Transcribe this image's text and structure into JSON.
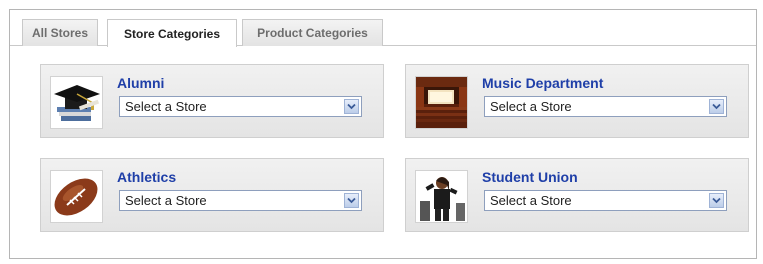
{
  "tabs": [
    {
      "label": "All Stores",
      "active": false
    },
    {
      "label": "Store Categories",
      "active": true
    },
    {
      "label": "Product Categories",
      "active": false
    }
  ],
  "categories": [
    {
      "title": "Alumni",
      "select_value": "Select a Store",
      "icon": "graduation-cap-icon"
    },
    {
      "title": "Music Department",
      "select_value": "Select a Store",
      "icon": "auditorium-icon"
    },
    {
      "title": "Athletics",
      "select_value": "Select a Store",
      "icon": "football-icon"
    },
    {
      "title": "Student Union",
      "select_value": "Select a Store",
      "icon": "student-icon"
    }
  ],
  "colors": {
    "title_link": "#1f3fa8",
    "card_bg": "#e9e9e9",
    "select_border": "#8e9fbd"
  }
}
